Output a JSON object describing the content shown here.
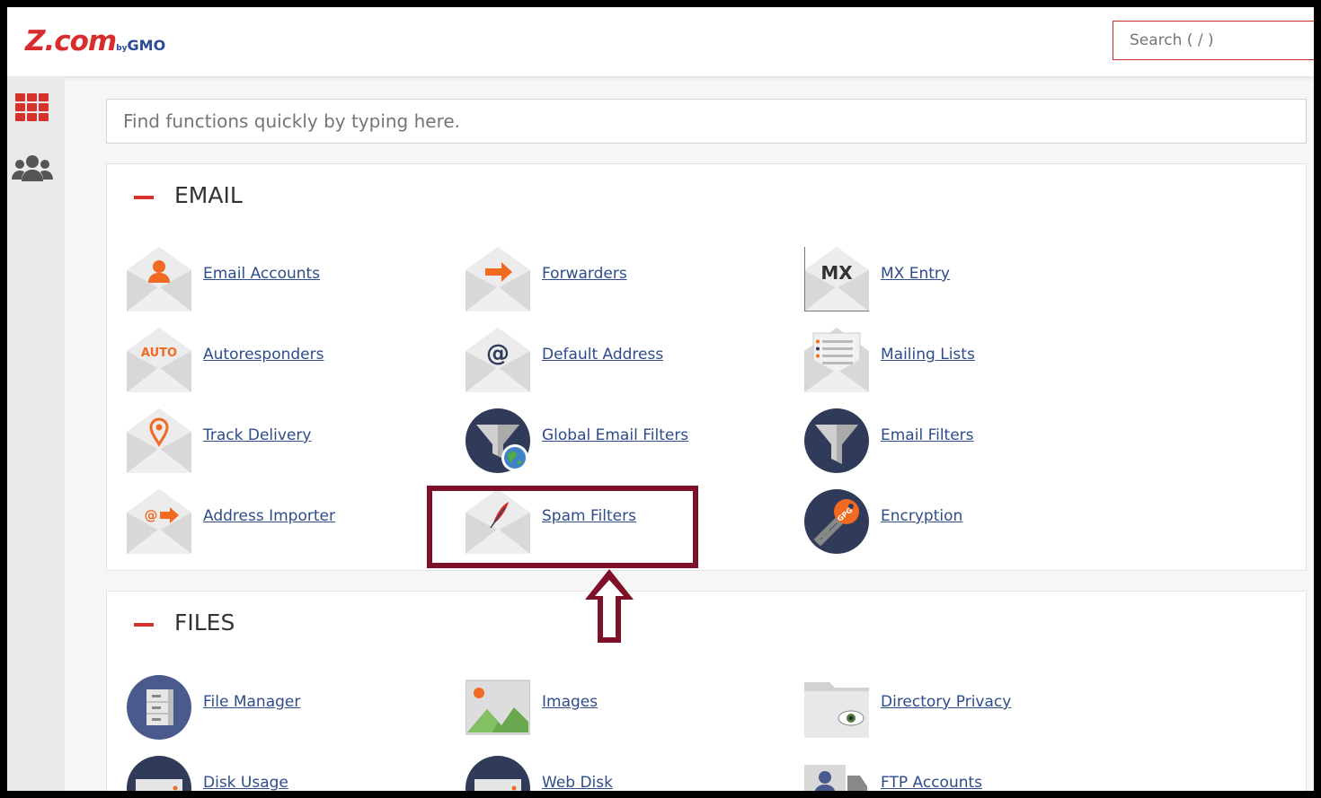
{
  "brand": {
    "logo_main": "Z.com",
    "logo_by": "by",
    "logo_gmo": "GMO"
  },
  "header": {
    "search_placeholder": "Search ( / )"
  },
  "quick_find": {
    "placeholder": "Find functions quickly by typing here."
  },
  "sections": {
    "email": {
      "title": "EMAIL",
      "items": [
        {
          "label": "Email Accounts",
          "icon": "envelope-person-icon"
        },
        {
          "label": "Forwarders",
          "icon": "envelope-arrow-icon"
        },
        {
          "label": "MX Entry",
          "icon": "envelope-mx-icon"
        },
        {
          "label": "Autoresponders",
          "icon": "envelope-auto-icon"
        },
        {
          "label": "Default Address",
          "icon": "envelope-at-icon"
        },
        {
          "label": "Mailing Lists",
          "icon": "envelope-list-icon"
        },
        {
          "label": "Track Delivery",
          "icon": "envelope-pin-icon"
        },
        {
          "label": "Global Email Filters",
          "icon": "funnel-globe-icon"
        },
        {
          "label": "Email Filters",
          "icon": "funnel-icon"
        },
        {
          "label": "Address Importer",
          "icon": "envelope-import-icon"
        },
        {
          "label": "Spam Filters",
          "icon": "envelope-feather-icon"
        },
        {
          "label": "Encryption",
          "icon": "key-gpg-icon"
        }
      ],
      "icon_texts": {
        "mx": "MX",
        "auto": "AUTO",
        "at": "@",
        "gpg": "GPG"
      }
    },
    "files": {
      "title": "FILES",
      "items": [
        {
          "label": "File Manager",
          "icon": "file-cabinet-icon"
        },
        {
          "label": "Images",
          "icon": "image-icon"
        },
        {
          "label": "Directory Privacy",
          "icon": "folder-eye-icon"
        },
        {
          "label": "Disk Usage",
          "icon": "disk-icon"
        },
        {
          "label": "Web Disk",
          "icon": "web-disk-icon"
        },
        {
          "label": "FTP Accounts",
          "icon": "ftp-user-icon"
        }
      ]
    }
  },
  "colors": {
    "accent": "#d7312c",
    "link": "#2e4c8c",
    "highlight": "#7e1027",
    "icon_orange": "#f26a21",
    "icon_navy": "#2f3b59"
  }
}
